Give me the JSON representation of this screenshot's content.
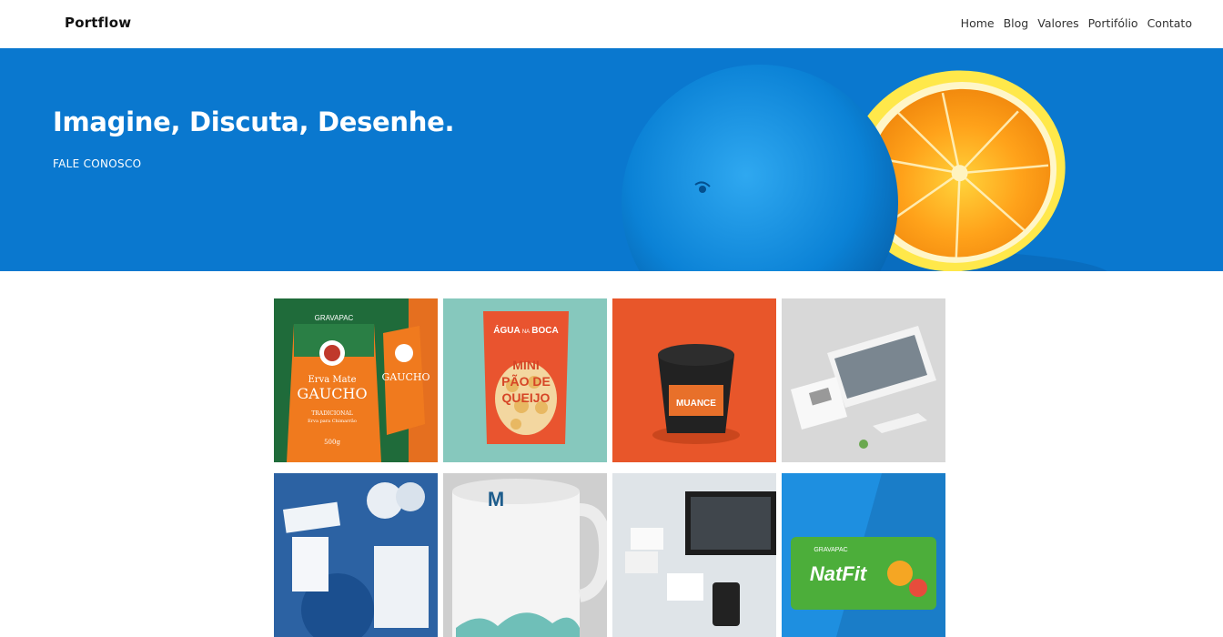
{
  "nav": {
    "brand": "Portflow",
    "links": [
      "Home",
      "Blog",
      "Valores",
      "Portifólio",
      "Contato"
    ]
  },
  "hero": {
    "title": "Imagine, Discuta, Desenhe.",
    "cta": "FALE CONOSCO",
    "bg_color": "#0a78cf"
  },
  "portfolio": {
    "items": [
      {
        "name": "erva-mate-gaucho-packaging",
        "brand": "GRAVAPAC",
        "line1": "Erva Mate",
        "line2": "GAUCHO",
        "tag": "TRADICIONAL",
        "sub": "Erva para Chimarrão",
        "weight": "500g"
      },
      {
        "name": "agua-na-boca-packaging",
        "top": "ÁGUA",
        "mid": "NA",
        "top2": "BOCA",
        "l1": "MINI",
        "l2": "PÃO DE",
        "l3": "QUEIJO"
      },
      {
        "name": "muance-cup-mockup",
        "label": "MUANCE"
      },
      {
        "name": "website-isometric-mockup"
      },
      {
        "name": "stationery-identity-mockup"
      },
      {
        "name": "mug-mockup",
        "letter": "M"
      },
      {
        "name": "web-devices-mockup"
      },
      {
        "name": "nutfit-packaging",
        "brand": "GRAVAPAC",
        "label": "NatFit"
      }
    ]
  }
}
